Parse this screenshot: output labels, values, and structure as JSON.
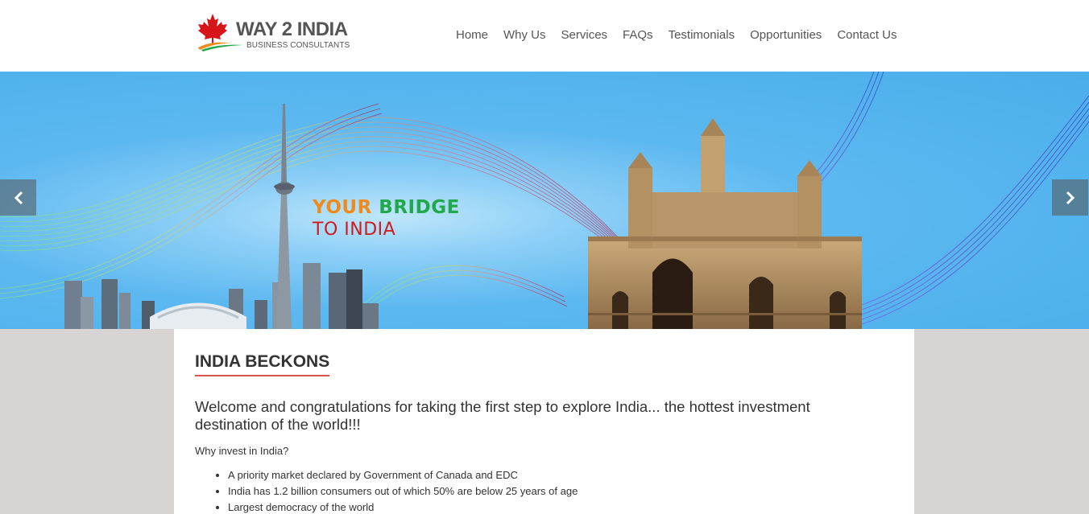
{
  "brand": {
    "title": "WAY 2 INDIA",
    "subtitle": "BUSINESS CONSULTANTS"
  },
  "nav": {
    "items": [
      "Home",
      "Why Us",
      "Services",
      "FAQs",
      "Testimonials",
      "Opportunities",
      "Contact Us"
    ]
  },
  "banner": {
    "tagline_word1": "YOUR",
    "tagline_word2": "BRIDGE",
    "tagline_line2": "TO INDIA",
    "prev_icon": "chevron-left-icon",
    "next_icon": "chevron-right-icon"
  },
  "content": {
    "title": "INDIA BECKONS",
    "lead": "Welcome and congratulations for taking the first step to explore India... the hottest investment destination of the world!!!",
    "question": "Why invest in India?",
    "bullets": [
      "A priority market declared by Government of Canada and EDC",
      "India has 1.2 billion consumers out of which 50% are below 25 years of age",
      "Largest democracy of the world"
    ]
  },
  "colors": {
    "accent_red": "#d9534f",
    "saffron": "#f08a1c",
    "green": "#20a84a",
    "banner_blue": "#4aaeeb"
  }
}
